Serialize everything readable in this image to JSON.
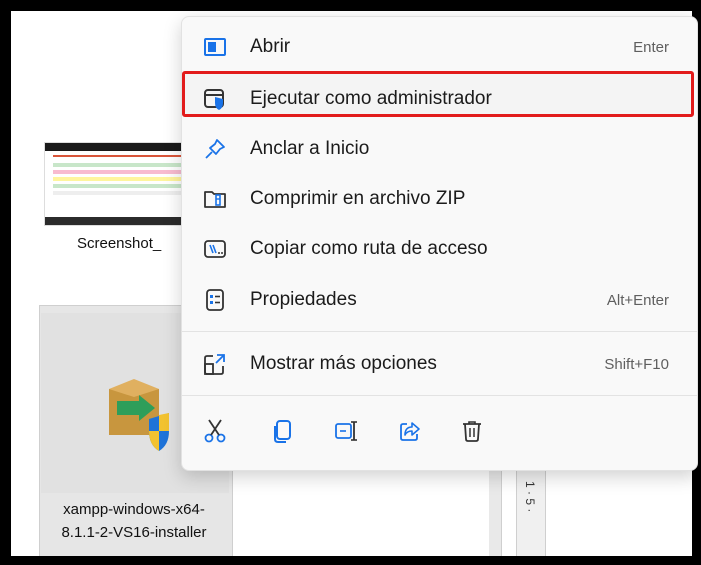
{
  "desktop": {
    "screenshot_label": "Screenshot_",
    "xampp_label_line1": "xampp-windows-x64-",
    "xampp_label_line2": "8.1.1-2-VS16-installer",
    "ruler_text": "1 · 5 ·"
  },
  "menu": {
    "items": [
      {
        "label": "Abrir",
        "shortcut": "Enter",
        "icon": "open-app-icon"
      },
      {
        "label": "Ejecutar como administrador",
        "shortcut": "",
        "icon": "shield-window-icon",
        "highlighted": true
      },
      {
        "label": "Anclar a Inicio",
        "shortcut": "",
        "icon": "pin-icon"
      },
      {
        "label": "Comprimir en archivo ZIP",
        "shortcut": "",
        "icon": "zip-folder-icon"
      },
      {
        "label": "Copiar como ruta de acceso",
        "shortcut": "",
        "icon": "path-icon"
      },
      {
        "label": "Propiedades",
        "shortcut": "Alt+Enter",
        "icon": "properties-icon"
      },
      {
        "label": "Mostrar más opciones",
        "shortcut": "Shift+F10",
        "icon": "more-options-icon"
      }
    ],
    "toolbar": [
      "cut-icon",
      "copy-icon",
      "rename-icon",
      "share-icon",
      "delete-icon"
    ]
  },
  "colors": {
    "highlight_border": "#e21b1b",
    "accent_blue": "#1a73e8"
  }
}
